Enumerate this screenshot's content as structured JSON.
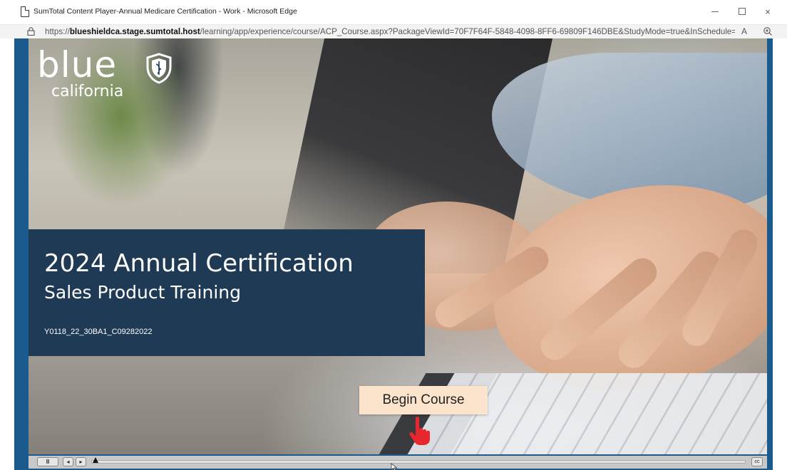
{
  "window": {
    "title": "SumTotal Content Player-Annual Medicare Certification - Work - Microsoft Edge",
    "controls": {
      "minimize": "−",
      "maximize": "□",
      "close": "×"
    }
  },
  "address_bar": {
    "url_prefix": "https://",
    "url_host": "blueshieldca.stage.sumtotal.host",
    "url_path": "/learning/app/experience/course/ACP_Course.aspx?PackageViewId=70F7F64F-5848-4098-8FF6-69809F146DBE&StudyMode=true&InSchedule=tr...",
    "read_aloud_label": "A",
    "icons": [
      "lock-icon",
      "read-aloud-icon",
      "zoom-icon"
    ]
  },
  "course": {
    "logo": {
      "word": "blue",
      "sub": "california"
    },
    "title": "2024 Annual Certification",
    "subtitle": "Sales Product Training",
    "code": "Y0118_22_30BA1_C09282022",
    "begin_button": "Begin Course"
  },
  "player_controls": {
    "pause_label": "II",
    "prev_label": "◂",
    "next_label": "▸",
    "cc_label": "cc",
    "progress": 0.0
  },
  "colors": {
    "frame_blue": "#1b5a8c",
    "panel_navy": "#1f3a55",
    "button_peach": "#fbe3cc",
    "cursor_red": "#e8262e"
  }
}
